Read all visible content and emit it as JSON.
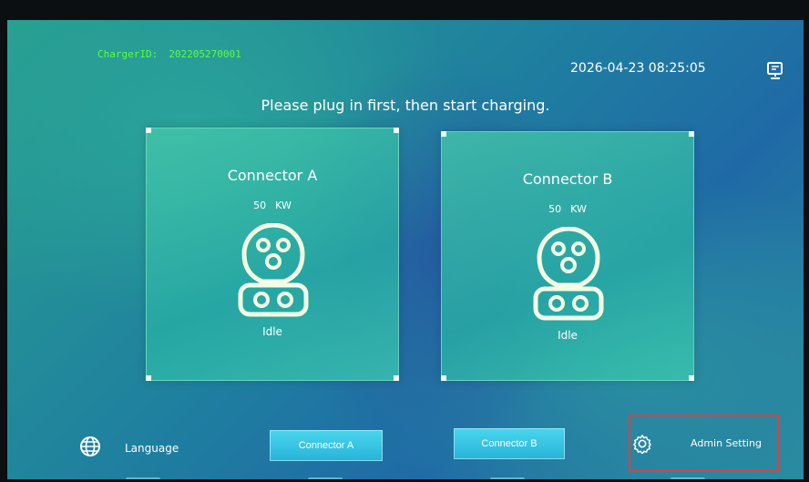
{
  "header": {
    "charger_id_label": "ChargerID:",
    "charger_id_value": "202205270001",
    "datetime": "2026-04-23 08:25:05",
    "monitor_icon": "monitor-network-icon"
  },
  "instruction": "Please plug in first, then start charging.",
  "connectors": [
    {
      "title": "Connector A",
      "power_value": "50",
      "power_unit": "KW",
      "status": "Idle",
      "icon": "ev-plug-icon"
    },
    {
      "title": "Connector B",
      "power_value": "50",
      "power_unit": "KW",
      "status": "Idle",
      "icon": "ev-plug-icon"
    }
  ],
  "footer": {
    "language_icon": "globe-icon",
    "language_label": "Language",
    "connector_a_button": "Connector A",
    "connector_b_button": "Connector B",
    "admin_icon": "gear-icon",
    "admin_label": "Admin Setting"
  },
  "colors": {
    "charger_id": "#5cff3a",
    "highlight_box": "#e43d3d",
    "button": "#3cc6e6"
  }
}
